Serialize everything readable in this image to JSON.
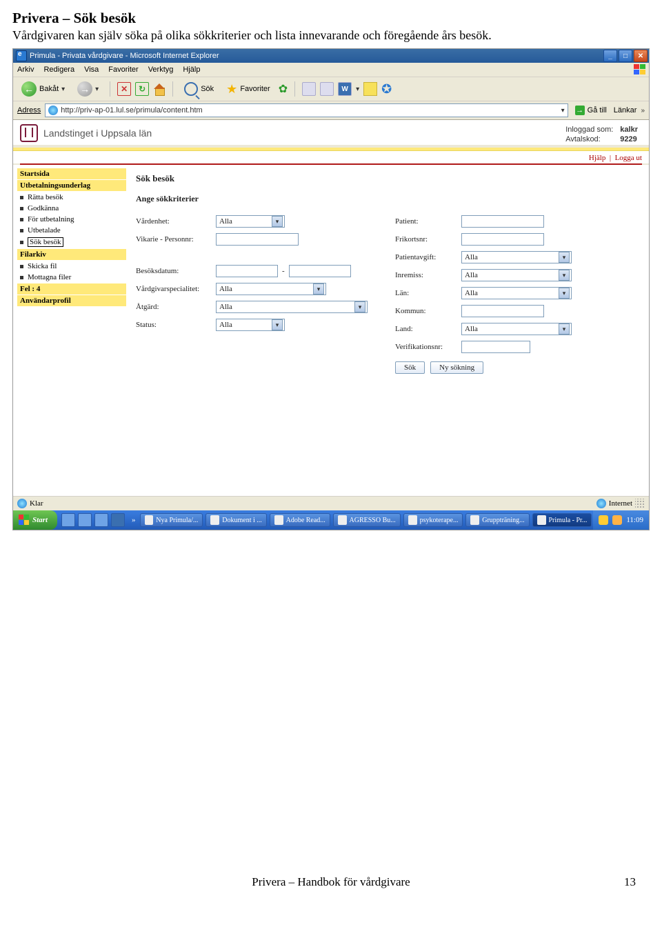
{
  "doc": {
    "title": "Privera – Sök besök",
    "subtitle": "Vårdgivaren kan själv söka på olika sökkriterier och lista innevarande och föregående års besök.",
    "footer": "Privera – Handbok för vårdgivare",
    "pagenum": "13"
  },
  "window": {
    "title": "Primula - Privata vårdgivare - Microsoft Internet Explorer"
  },
  "menu": {
    "arkiv": "Arkiv",
    "redigera": "Redigera",
    "visa": "Visa",
    "favoriter": "Favoriter",
    "verktyg": "Verktyg",
    "hjalp": "Hjälp"
  },
  "toolbar": {
    "back": "Bakåt",
    "search": "Sök",
    "favorites": "Favoriter"
  },
  "addrbar": {
    "label": "Adress",
    "url": "http://priv-ap-01.lul.se/primula/content.htm",
    "go": "Gå till",
    "links": "Länkar"
  },
  "banner": {
    "org": "Landstinget i Uppsala län",
    "logged_lbl": "Inloggad som:",
    "logged_val": "kalkr",
    "code_lbl": "Avtalskod:",
    "code_val": "9229",
    "help": "Hjälp",
    "logout": "Logga ut"
  },
  "sidebar": {
    "startsida": "Startsida",
    "utbund": "Utbetalningsunderlag",
    "ratta": "Rätta besök",
    "godkanna": "Godkänna",
    "forutb": "För utbetalning",
    "utbetalade": "Utbetalade",
    "sokbesok": "Sök besök",
    "filarkiv": "Filarkiv",
    "skicka": "Skicka fil",
    "mottagna": "Mottagna filer",
    "fel": "Fel : 4",
    "profil": "Användarprofil"
  },
  "main": {
    "h2": "Sök besök",
    "h3": "Ange sökkriterier",
    "left": {
      "vardenhet_lbl": "Vårdenhet:",
      "vardenhet_val": "Alla",
      "vikarie_lbl": "Vikarie - Personnr:",
      "besoksdatum_lbl": "Besöksdatum:",
      "dash": "-",
      "spec_lbl": "Vårdgivarspecialitet:",
      "spec_val": "Alla",
      "atgard_lbl": "Åtgärd:",
      "atgard_val": "Alla",
      "status_lbl": "Status:",
      "status_val": "Alla"
    },
    "right": {
      "patient_lbl": "Patient:",
      "frikort_lbl": "Frikortsnr:",
      "avgift_lbl": "Patientavgift:",
      "avgift_val": "Alla",
      "inremiss_lbl": "Inremiss:",
      "inremiss_val": "Alla",
      "lan_lbl": "Län:",
      "lan_val": "Alla",
      "kommun_lbl": "Kommun:",
      "land_lbl": "Land:",
      "land_val": "Alla",
      "verif_lbl": "Verifikationsnr:"
    },
    "btn_search": "Sök",
    "btn_new": "Ny sökning"
  },
  "status": {
    "left": "Klar",
    "right": "Internet"
  },
  "taskbar": {
    "start": "Start",
    "arrow": "»",
    "tasks": [
      "Nya Primula/...",
      "Dokument i ...",
      "Adobe Read...",
      "AGRESSO Bu...",
      "psykoterape...",
      "Gruppträning...",
      "Primula - Pr..."
    ],
    "time": "11:09"
  }
}
